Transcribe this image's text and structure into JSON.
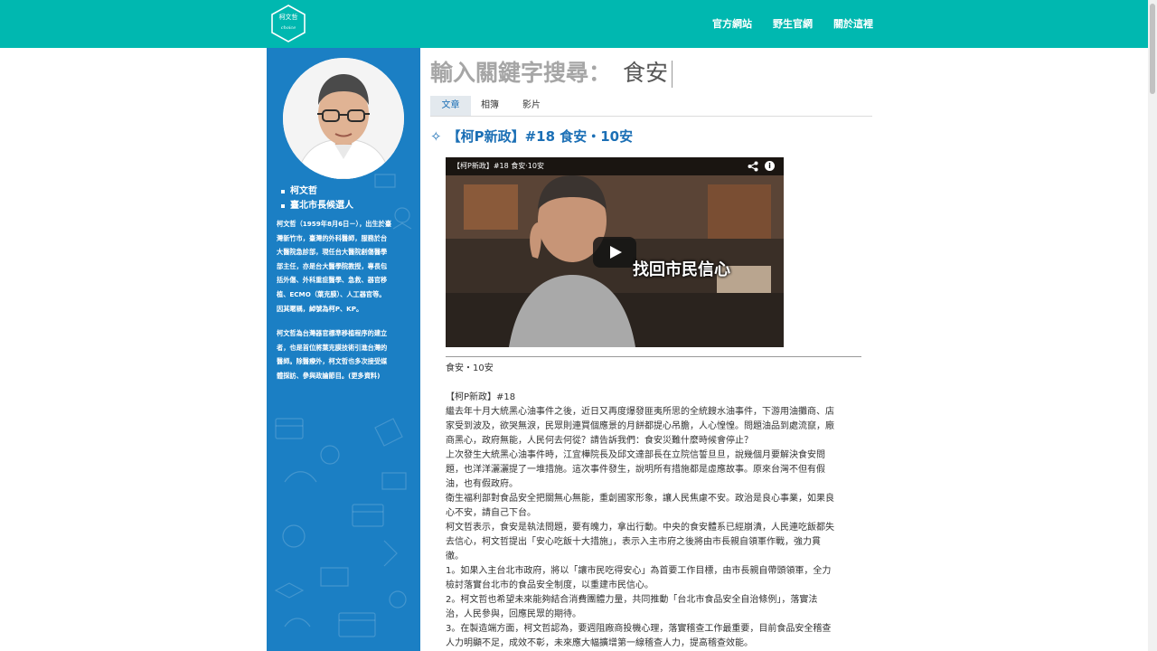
{
  "header": {
    "logo_text": "柯文哲",
    "logo_sub": "choice",
    "nav": [
      "官方網站",
      "野生官網",
      "關於這裡"
    ]
  },
  "sidebar": {
    "items": [
      "柯文哲",
      "臺北市長候選人"
    ],
    "bio_lines": [
      "柯文哲（1959年8月6日－），出生於臺",
      "灣新竹市，臺灣的外科醫師，服務於台",
      "大醫院急診部，現任台大醫院創傷醫學",
      "部主任，亦是台大醫學院教授，專長包",
      "括外傷、外科重症醫學、急救、器官移",
      "植、ECMO（葉克膜）、人工器官等。",
      "因其暱稱，綽號為柯P、KP。"
    ],
    "bio2_lines": [
      "柯文哲為台灣器官標準移植程序的建立",
      "者，也是首位將葉克膜技術引進台灣的",
      "醫師。除醫療外，柯文哲也多次接受媒",
      "體採訪、參與政論節目。(更多資料)"
    ]
  },
  "search": {
    "prefix": "輸入關鍵字搜尋：",
    "value": "食安"
  },
  "tabs": [
    "文章",
    "相簿",
    "影片"
  ],
  "post": {
    "title": "【柯P新政】#18 食安・10安",
    "video_title": "【柯P新政】#18 食安·10安",
    "video_caption": "找回市民信心",
    "subtitle": "食安・10安",
    "heading": "【柯P新政】#18",
    "lines": [
      "繼去年十月大統黑心油事件之後，近日又再度爆發匪夷所思的全統餿水油事件，下游用油攤商、店",
      "家受到波及，欲哭無淚，民眾則連買個應景的月餅都提心吊膽，人心惶惶。問題油品到處流竄，廠",
      "商黑心，政府無能，人民何去何從？請告訴我們：食安災難什麼時候會停止？",
      "上次發生大統黑心油事件時，江宜樺院長及邱文達部長在立院信誓旦旦，說幾個月要解決食安問",
      "題，也洋洋灑灑提了一堆措施。這次事件發生，說明所有措施都是虛應故事。原來台灣不但有假",
      "油，也有假政府。",
      "衛生福利部對食品安全把關無心無能，重創國家形象，讓人民焦慮不安。政治是良心事業，如果良",
      "心不安，請自己下台。",
      "柯文哲表示，食安是執法問題，要有魄力，拿出行動。中央的食安體系已經崩潰，人民連吃飯都失",
      "去信心，柯文哲提出「安心吃飯十大措施」，表示入主市府之後將由市長親自領軍作戰，強力貫",
      "徹。",
      "1。如果入主台北市政府，將以「讓市民吃得安心」為首要工作目標，由市長親自帶頭領軍，全力",
      "檢討落實台北市的食品安全制度，以重建市民信心。",
      "2。柯文哲也希望未來能夠結合消費團體力量，共同推動「台北市食品安全自治條例」，落實法",
      "治，人民參與，回應民眾的期待。",
      "3。在製造端方面，柯文哲認為，要週阻廠商投機心理，落實稽查工作最重要，目前食品安全稽查",
      "人力明顯不足，成效不彰，未來應大幅擴增第一線稽查人力，提高稽查效能。"
    ]
  },
  "colors": {
    "topbar": "#00b8b0",
    "sidebar": "#1b7fc4",
    "title": "#1b6fb5"
  }
}
